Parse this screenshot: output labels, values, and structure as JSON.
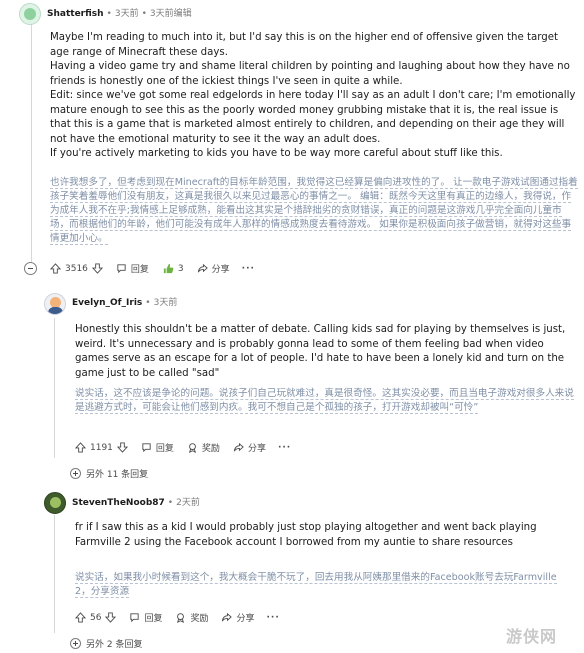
{
  "comments": [
    {
      "username": "Shatterfish",
      "time": "3天前",
      "edited": "3天前编辑",
      "paragraphs": [
        "Maybe I'm reading to much into it, but I'd say this is on the higher end of offensive given the target age range of Minecraft these days.",
        "Having a video game try and shame literal children by pointing and laughing about how they have no friends is honestly one of the ickiest things I've seen in quite a while.",
        "Edit: since we've got some real edgelords in here today I'll say as an adult I don't care; I'm emotionally mature enough to see this as the poorly worded money grubbing mistake that it is, the real issue is that this is a game that is marketed almost entirely to children, and depending on their age they will not have the emotional maturity to see it the way an adult does.",
        "If you're actively marketing to kids you have to be way more careful about stuff like this."
      ],
      "translation": "也许我想多了，但考虑到现在Minecraft的目标年龄范围，我觉得这已经算是偏向进攻性的了。 让一款电子游戏试图通过指着孩子笑着羞辱他们没有朋友，这真是我很久以来见过最恶心的事情之一。 编辑：既然今天这里有真正的边缘人，我得说，作为成年人我不在乎;我情感上足够成熟，能看出这其实是个措辞拙劣的贪财错误，真正的问题是这游戏几乎完全面向儿童市场，而根据他们的年龄，他们可能没有成年人那样的情感成熟度去看待游戏。 如果你是积极面向孩子做营销，就得对这些事情更加小心。",
      "score": "3516",
      "reply_label": "回复",
      "award_count": "3",
      "share_label": "分享",
      "more_label": "···"
    },
    {
      "username": "Evelyn_Of_Iris",
      "time": "3天前",
      "paragraphs": [
        "Honestly this shouldn't be a matter of debate. Calling kids sad for playing by themselves is just, weird. It's unnecessary and is probably gonna lead to some of them feeling bad when video games serve as an escape for a lot of people. I'd hate to have been a lonely kid and turn on the game just to be called \"sad\""
      ],
      "translation": "说实话，这不应该是争论的问题。说孩子们自己玩就难过，真是很奇怪。这其实没必要，而且当电子游戏对很多人来说是逃避方式时，可能会让他们感到内疚。我可不想自己是个孤独的孩子，打开游戏却被叫“可怜”",
      "score": "1191",
      "reply_label": "回复",
      "award_label": "奖励",
      "share_label": "分享",
      "more_label": "···",
      "more_replies": "另外 11 条回复"
    },
    {
      "username": "StevenTheNoob87",
      "time": "2天前",
      "paragraphs": [
        "fr if I saw this as a kid I would probably just stop playing altogether and went back playing Farmville 2 using the Facebook account I borrowed from my auntie to share resources"
      ],
      "translation": "说实话，如果我小时候看到这个，我大概会干脆不玩了，回去用我从阿姨那里借来的Facebook账号去玩Farmville 2，分享资源",
      "score": "56",
      "reply_label": "回复",
      "award_label": "奖励",
      "share_label": "分享",
      "more_label": "···",
      "more_replies": "另外 2 条回复"
    }
  ],
  "watermark": "游侠网",
  "colors": {
    "translation": "#7f8fa6",
    "meta": "#7c7c7c",
    "rail": "#d7d7d7"
  }
}
